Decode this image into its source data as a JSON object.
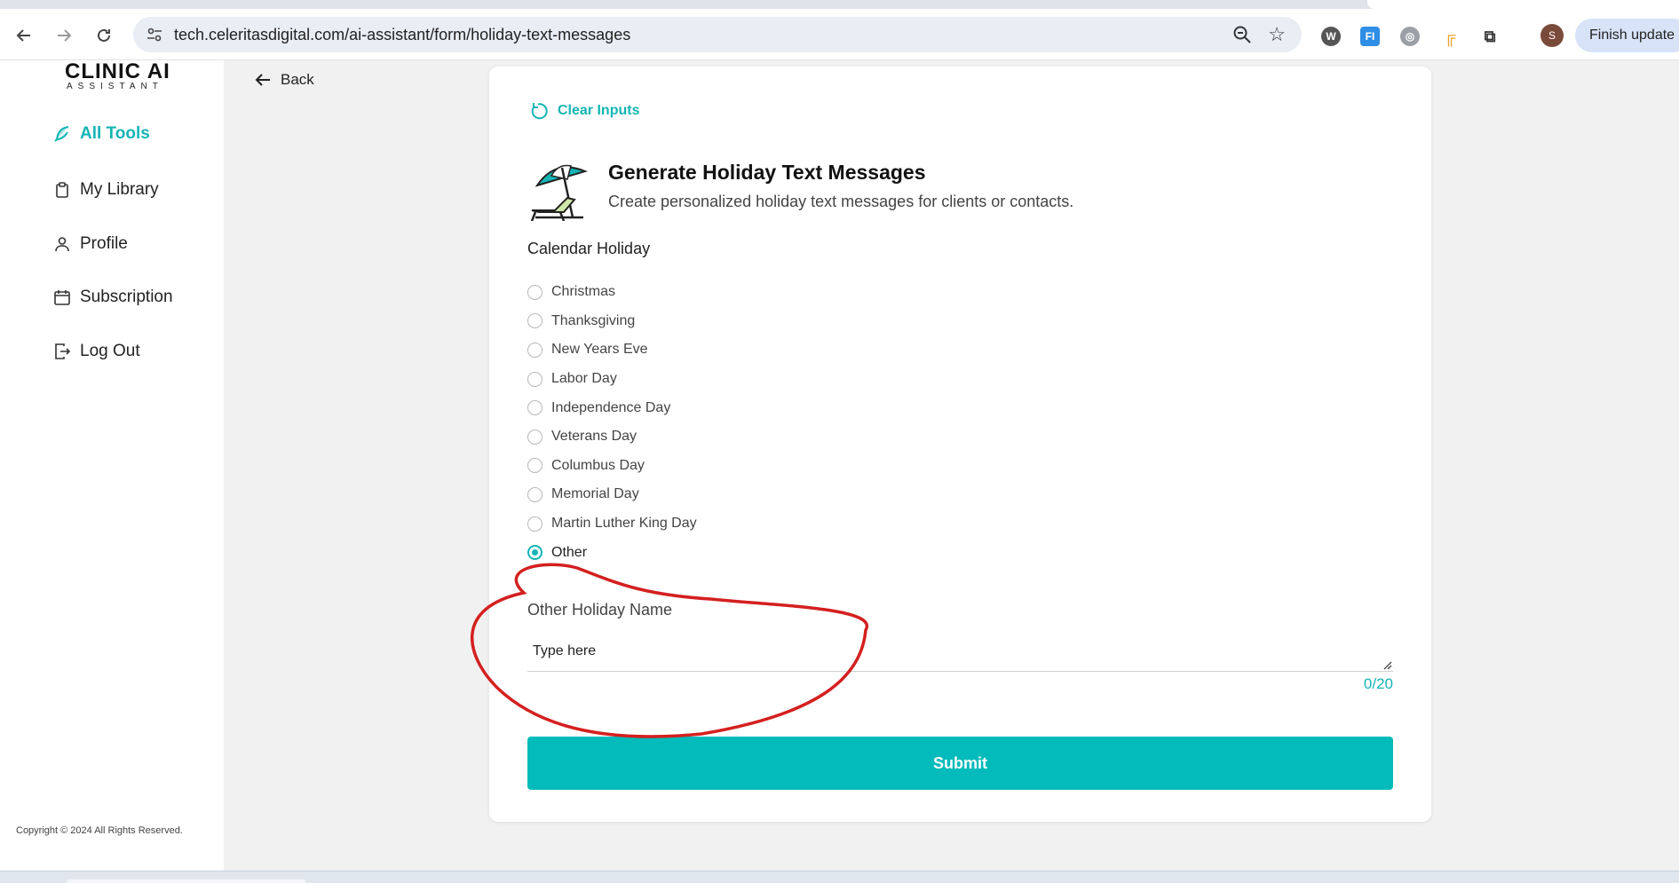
{
  "browser": {
    "url": "tech.celeritasdigital.com/ai-assistant/form/holiday-text-messages",
    "profile_initial": "S",
    "finish_update_label": "Finish update",
    "extensions": [
      "w-extension-icon",
      "fi-extension-icon",
      "globe-extension-icon",
      "grid-extension-icon",
      "puzzle-extension-icon"
    ]
  },
  "sidebar": {
    "logo_line1": "CLINIC AI",
    "logo_line2": "ASSISTANT",
    "items": [
      {
        "label": "All Tools",
        "icon": "feather-icon",
        "active": true
      },
      {
        "label": "My Library",
        "icon": "clipboard-icon",
        "active": false
      },
      {
        "label": "Profile",
        "icon": "user-icon",
        "active": false
      },
      {
        "label": "Subscription",
        "icon": "calendar-icon",
        "active": false
      },
      {
        "label": "Log Out",
        "icon": "logout-icon",
        "active": false
      }
    ],
    "copyright": "Copyright © 2024 All Rights Reserved."
  },
  "back_label": "Back",
  "form": {
    "clear_label": "Clear Inputs",
    "title": "Generate Holiday Text Messages",
    "subtitle": "Create personalized holiday text messages for clients or contacts.",
    "section_label": "Calendar Holiday",
    "options": [
      "Christmas",
      "Thanksgiving",
      "New Years Eve",
      "Labor Day",
      "Independence Day",
      "Veterans Day",
      "Columbus Day",
      "Memorial Day",
      "Martin Luther King Day",
      "Other"
    ],
    "selected_option": "Other",
    "other_label": "Other Holiday Name",
    "other_placeholder": "Type here",
    "counter": "0/20",
    "submit_label": "Submit"
  },
  "colors": {
    "accent": "#14b5b4",
    "submit_bg": "#04bbbb",
    "annotation": "#d42020"
  }
}
